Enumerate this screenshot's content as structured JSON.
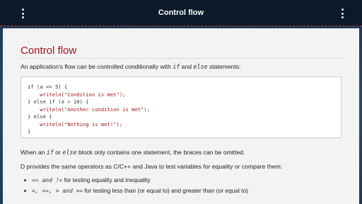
{
  "header": {
    "title": "Control flow"
  },
  "content": {
    "heading": "Control flow",
    "intro": {
      "before": "An application's flow can be controlled conditionally with",
      "code1": "if",
      "mid": "and",
      "code2": "else",
      "after": "statements:"
    },
    "code_lines": [
      "if (a == 5) {",
      "    writeln(\"Condition is met\");",
      "} else if (a > 10) {",
      "    writeln(\"Another condition is met\");",
      "} else {",
      "    writeln(\"Nothing is met!\");",
      "}"
    ],
    "para2": {
      "before": "When an",
      "code1": "if",
      "mid": "or",
      "code2": "else",
      "after": "block only contains one statement, the braces can be omitted."
    },
    "para3": "D provides the same operators as C/C++ and Java to test variables for equality or compare them:",
    "bullets": [
      {
        "ops": "== and  !=",
        "text": "for testing equality and inequality"
      },
      {
        "ops": "<,  <=,  > and  >=",
        "text": "for testing less than (or equal to) and greater than (or equal to)"
      }
    ]
  },
  "colors": {
    "accent": "#a3151e",
    "topbar": "#0b1a2a"
  }
}
